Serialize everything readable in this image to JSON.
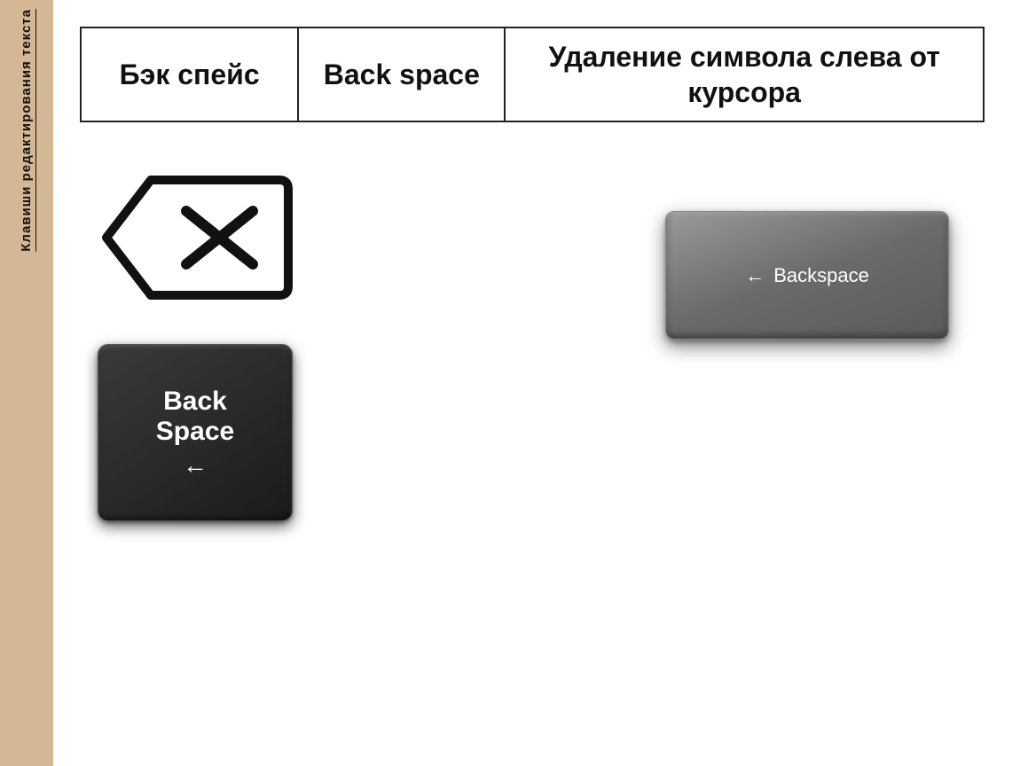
{
  "sidebar": {
    "text": "Клавиши редактирования текста"
  },
  "table": {
    "col1": "Бэк спейс",
    "col2": "Back space",
    "col3": "Удаление символа слева от курсора"
  },
  "key_dark": {
    "line1": "Back",
    "line2": "Space",
    "arrow": "←"
  },
  "key_gray": {
    "arrow": "←",
    "label": "Backspace"
  }
}
